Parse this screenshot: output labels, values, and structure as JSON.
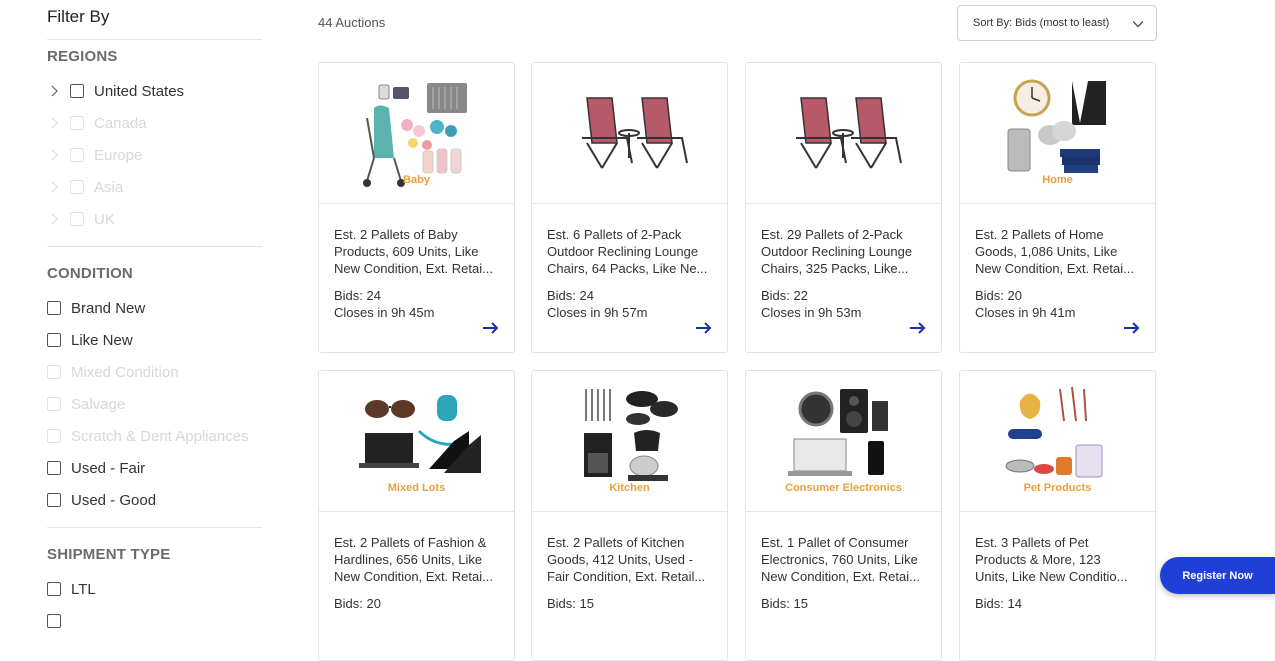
{
  "sidebar": {
    "title": "Filter By",
    "regions": {
      "heading": "REGIONS",
      "items": [
        "United States",
        "Canada",
        "Europe",
        "Asia",
        "UK"
      ]
    },
    "condition": {
      "heading": "CONDITION",
      "items": [
        "Brand New",
        "Like New",
        "Mixed Condition",
        "Salvage",
        "Scratch & Dent Appliances",
        "Used - Fair",
        "Used - Good"
      ]
    },
    "shipment": {
      "heading": "SHIPMENT TYPE",
      "items": [
        "LTL"
      ]
    }
  },
  "header": {
    "count": "44 Auctions",
    "sort_label": "Sort By: Bids (most to least)"
  },
  "cards": [
    {
      "image_label": "Baby",
      "title_lines": [
        "Est. 2 Pallets of Baby",
        "Products, 609 Units, Like",
        "New Condition, Ext. Retai..."
      ],
      "bids": "Bids: 24",
      "closes": "Closes in 9h 45m"
    },
    {
      "image_label": "",
      "title_lines": [
        "Est. 6 Pallets of 2-Pack",
        "Outdoor Reclining Lounge",
        "Chairs, 64 Packs, Like Ne..."
      ],
      "bids": "Bids: 24",
      "closes": "Closes in 9h 57m"
    },
    {
      "image_label": "",
      "title_lines": [
        "Est. 29 Pallets of 2-Pack",
        "Outdoor Reclining Lounge",
        "Chairs, 325 Packs, Like..."
      ],
      "bids": "Bids: 22",
      "closes": "Closes in 9h 53m"
    },
    {
      "image_label": "Home",
      "title_lines": [
        "Est. 2 Pallets of Home",
        "Goods, 1,086 Units, Like",
        "New Condition, Ext. Retai..."
      ],
      "bids": "Bids: 20",
      "closes": "Closes in 9h 41m"
    },
    {
      "image_label": "Mixed Lots",
      "title_lines": [
        "Est. 2 Pallets of Fashion &",
        "Hardlines, 656 Units, Like",
        "New Condition, Ext. Retai..."
      ],
      "bids": "Bids: 20",
      "closes": ""
    },
    {
      "image_label": "Kitchen",
      "title_lines": [
        "Est. 2 Pallets of Kitchen",
        "Goods, 412 Units, Used -",
        "Fair Condition, Ext. Retail..."
      ],
      "bids": "Bids: 15",
      "closes": ""
    },
    {
      "image_label": "Consumer Electronics",
      "title_lines": [
        "Est. 1 Pallet of Consumer",
        "Electronics, 760 Units, Like",
        "New Condition, Ext. Retai..."
      ],
      "bids": "Bids: 15",
      "closes": ""
    },
    {
      "image_label": "Pet Products",
      "title_lines": [
        "Est. 3 Pallets of Pet",
        "Products & More, 123",
        "Units, Like New Conditio..."
      ],
      "bids": "Bids: 14",
      "closes": ""
    }
  ],
  "register_label": "Register Now",
  "colors": {
    "accent": "#1f3fd6",
    "arrow": "#1a2fa8",
    "label_orange": "#e8a03c"
  }
}
